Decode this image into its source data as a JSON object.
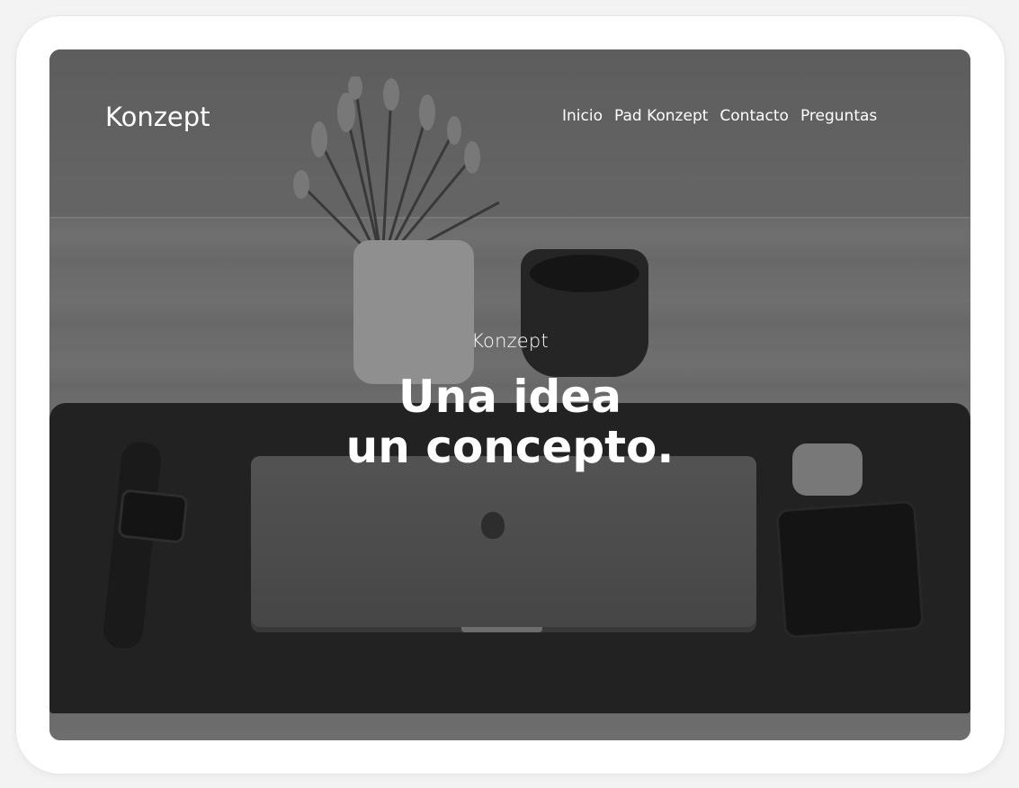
{
  "header": {
    "brand": "Konzept"
  },
  "nav": {
    "items": [
      {
        "label": "Inicio"
      },
      {
        "label": "Pad Konzept"
      },
      {
        "label": "Contacto"
      },
      {
        "label": "Preguntas"
      }
    ]
  },
  "hero": {
    "subtitle": "Konzept",
    "title_line1": "Una idea",
    "title_line2": "un concepto."
  },
  "colors": {
    "text": "#ffffff",
    "frame": "#ffffff",
    "overlay": "#000000"
  }
}
